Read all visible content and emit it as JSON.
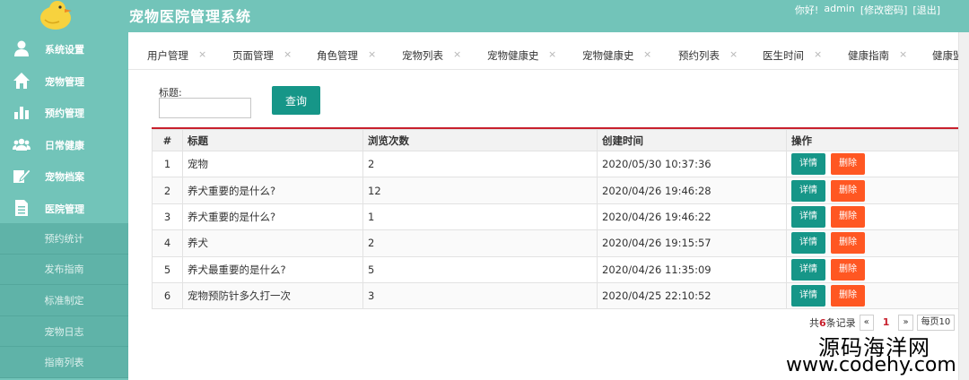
{
  "app": {
    "title": "宠物医院管理系统"
  },
  "user": {
    "greeting": "你好!",
    "name": "admin",
    "change_password": "[修改密码]",
    "logout": "[退出]"
  },
  "sidebar": {
    "items": [
      {
        "label": "系统设置",
        "icon": "user-icon"
      },
      {
        "label": "宠物管理",
        "icon": "home-icon"
      },
      {
        "label": "预约管理",
        "icon": "bar-chart-icon"
      },
      {
        "label": "日常健康",
        "icon": "group-icon"
      },
      {
        "label": "宠物档案",
        "icon": "edit-icon"
      },
      {
        "label": "医院管理",
        "icon": "document-icon"
      }
    ],
    "subitems": [
      {
        "label": "预约统计"
      },
      {
        "label": "发布指南"
      },
      {
        "label": "标准制定"
      },
      {
        "label": "宠物日志"
      },
      {
        "label": "指南列表"
      }
    ]
  },
  "tabs": [
    {
      "label": "用户管理"
    },
    {
      "label": "页面管理"
    },
    {
      "label": "角色管理"
    },
    {
      "label": "宠物列表"
    },
    {
      "label": "宠物健康史"
    },
    {
      "label": "宠物健康史"
    },
    {
      "label": "预约列表"
    },
    {
      "label": "医生时间"
    },
    {
      "label": "健康指南"
    },
    {
      "label": "健康盟"
    }
  ],
  "tab_close_glyph": "×",
  "search": {
    "label": "标题:",
    "value": "",
    "button": "查询"
  },
  "table": {
    "columns": [
      "#",
      "标题",
      "浏览次数",
      "创建时间",
      "操作"
    ],
    "rows": [
      {
        "index": "1",
        "title": "宠物",
        "views": "2",
        "created": "2020/05/30 10:37:36"
      },
      {
        "index": "2",
        "title": "养犬重要的是什么?",
        "views": "12",
        "created": "2020/04/26 19:46:28"
      },
      {
        "index": "3",
        "title": "养犬重要的是什么?",
        "views": "1",
        "created": "2020/04/26 19:46:22"
      },
      {
        "index": "4",
        "title": "养犬",
        "views": "2",
        "created": "2020/04/26 19:15:57"
      },
      {
        "index": "5",
        "title": "养犬最重要的是什么?",
        "views": "5",
        "created": "2020/04/26 11:35:09"
      },
      {
        "index": "6",
        "title": "宠物预防针多久打一次",
        "views": "3",
        "created": "2020/04/25 22:10:52"
      }
    ],
    "detail_label": "详情",
    "delete_label": "删除"
  },
  "pager": {
    "total_prefix": "共",
    "total_count": "6",
    "total_suffix": "条记录",
    "prev": "«",
    "current": "1",
    "next": "»",
    "per_page": "每页10"
  },
  "watermark": {
    "line1": "源码海洋网",
    "line2": "www.codehy.com"
  },
  "colors": {
    "sidebar_bg": "#72c4b9",
    "primary_button": "#169688",
    "danger_button": "#ff5722",
    "table_accent": "#c8202d"
  }
}
